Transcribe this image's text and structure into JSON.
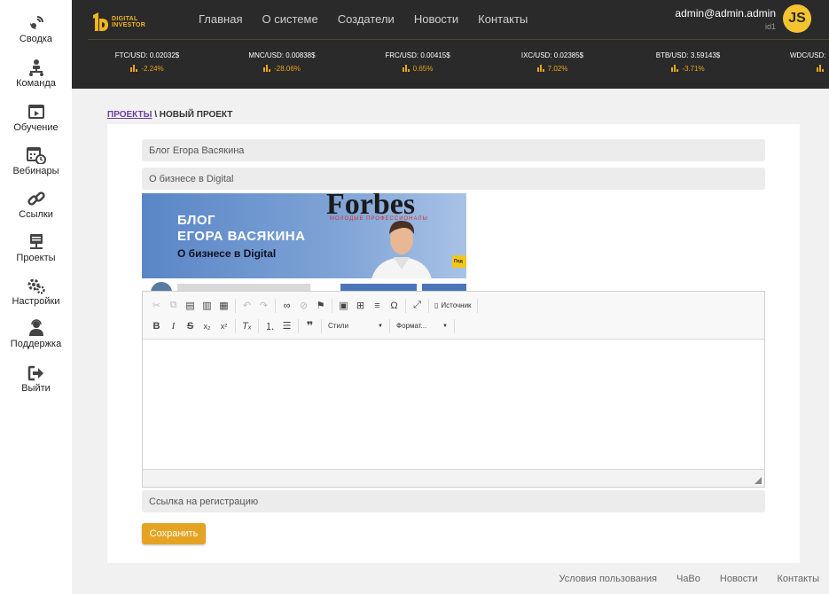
{
  "sidebar": {
    "items": [
      {
        "label": "Сводка",
        "icon": "satellite-dish-icon"
      },
      {
        "label": "Команда",
        "icon": "team-icon"
      },
      {
        "label": "Обучение",
        "icon": "video-icon"
      },
      {
        "label": "Вебинары",
        "icon": "calendar-clock-icon"
      },
      {
        "label": "Ссылки",
        "icon": "link-icon"
      },
      {
        "label": "Проекты",
        "icon": "projects-icon"
      },
      {
        "label": "Настройки",
        "icon": "gears-icon"
      },
      {
        "label": "Поддержка",
        "icon": "support-icon"
      },
      {
        "label": "Выйти",
        "icon": "logout-icon"
      }
    ]
  },
  "header": {
    "logo_line1": "DIGITAL",
    "logo_line2": "INVESTOR",
    "nav": [
      "Главная",
      "О системе",
      "Создатели",
      "Новости",
      "Контакты"
    ],
    "user_email": "admin@admin.admin",
    "user_id": "id1",
    "avatar_initials": "JS",
    "accent": "#e9a319"
  },
  "tickers": [
    {
      "pair": "FTC/USD: 0.02032$",
      "change": "-2.24%"
    },
    {
      "pair": "MNC/USD: 0.00838$",
      "change": "-28.06%"
    },
    {
      "pair": "FRC/USD: 0.00415$",
      "change": "0.65%"
    },
    {
      "pair": "IXC/USD: 0.02385$",
      "change": "7.02%"
    },
    {
      "pair": "BTB/USD: 3.59143$",
      "change": "-3.71%"
    },
    {
      "pair": "WDC/USD:",
      "change": ""
    }
  ],
  "breadcrumb": {
    "link": "ПРОЕКТЫ",
    "separator": " \\ ",
    "current": "НОВЫЙ ПРОЕКТ"
  },
  "form": {
    "title_value": "Блог Егора Васякина",
    "subtitle_value": "О бизнесе в Digital",
    "banner": {
      "line1": "БЛОГ",
      "line2": "ЕГОРА ВАСЯКИНА",
      "line3": "О бизнесе в Digital",
      "brand": "Forbes",
      "brand_sub": "МОЛОДЫЕ ПРОФЕССИОНАЛЫ",
      "badge": "Под"
    },
    "editor": {
      "source_label": "Источник",
      "styles_label": "Стили",
      "format_label": "Формат..."
    },
    "registration_placeholder": "Ссылка на регистрацию",
    "save_label": "Сохранить"
  },
  "footer": [
    "Условия пользования",
    "ЧаВо",
    "Новости",
    "Контакты"
  ]
}
